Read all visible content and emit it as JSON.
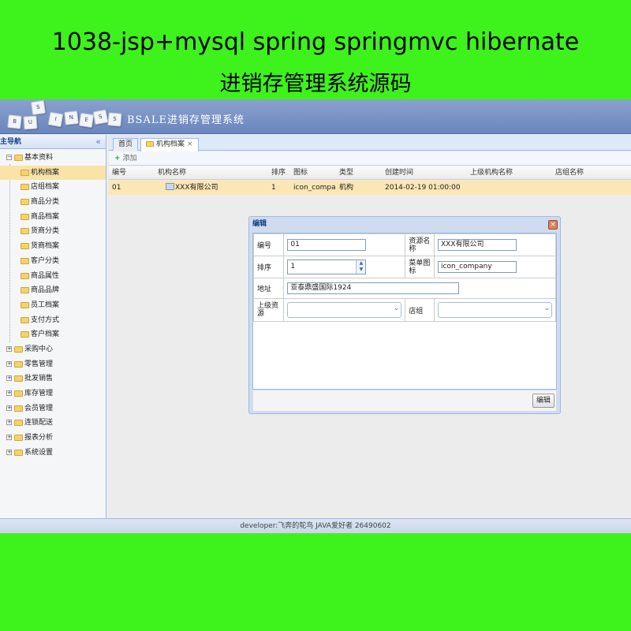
{
  "banner": {
    "line1": "1038-jsp+mysql spring springmvc hibernate",
    "line2": "进销存管理系统源码"
  },
  "header": {
    "logo_letters": [
      "S",
      "B",
      "U",
      "I",
      "N",
      "E",
      "S",
      "S"
    ],
    "title": "BSALE进销存管理系统"
  },
  "sidebar": {
    "title": "主导航",
    "collapse_icon": "«",
    "root": "基本资料",
    "children": [
      "机构档案",
      "店组档案",
      "商品分类",
      "商品档案",
      "货商分类",
      "货商档案",
      "客户分类",
      "商品属性",
      "商品品牌",
      "员工档案",
      "支付方式",
      "客户档案"
    ],
    "groups": [
      "采购中心",
      "零售管理",
      "批发销售",
      "库存管理",
      "会员管理",
      "连锁配送",
      "报表分析",
      "系统设置"
    ]
  },
  "tabs": [
    {
      "label": "首页"
    },
    {
      "label": "机构档案",
      "close": "×"
    }
  ],
  "toolbar": {
    "add_label": "添加",
    "add_icon": "+"
  },
  "grid": {
    "columns": [
      "编号",
      "机构名称",
      "排序",
      "图标",
      "类型",
      "创建时间",
      "上级机构名称",
      "店组名称"
    ],
    "rows": [
      [
        "01",
        "XXX有限公司",
        "1",
        "icon_company",
        "机构",
        "2014-02-19 01:00:00",
        "",
        ""
      ]
    ]
  },
  "dialog": {
    "title": "编辑",
    "close": "×",
    "fields": {
      "code_label": "编号",
      "code_value": "01",
      "name_label": "资源名称",
      "name_value": "XXX有限公司",
      "sort_label": "排序",
      "sort_value": "1",
      "icon_label": "菜单图标",
      "icon_value": "icon_company",
      "address_label": "地址",
      "address_value": "亚泰鼎盛国际1924",
      "parent_label": "上级资源",
      "parent_value": "",
      "store_label": "店组",
      "store_value": ""
    },
    "button_label": "编辑"
  },
  "footer": {
    "text": "developer:飞奔的鸵鸟 JAVA爱好者 26490602"
  }
}
